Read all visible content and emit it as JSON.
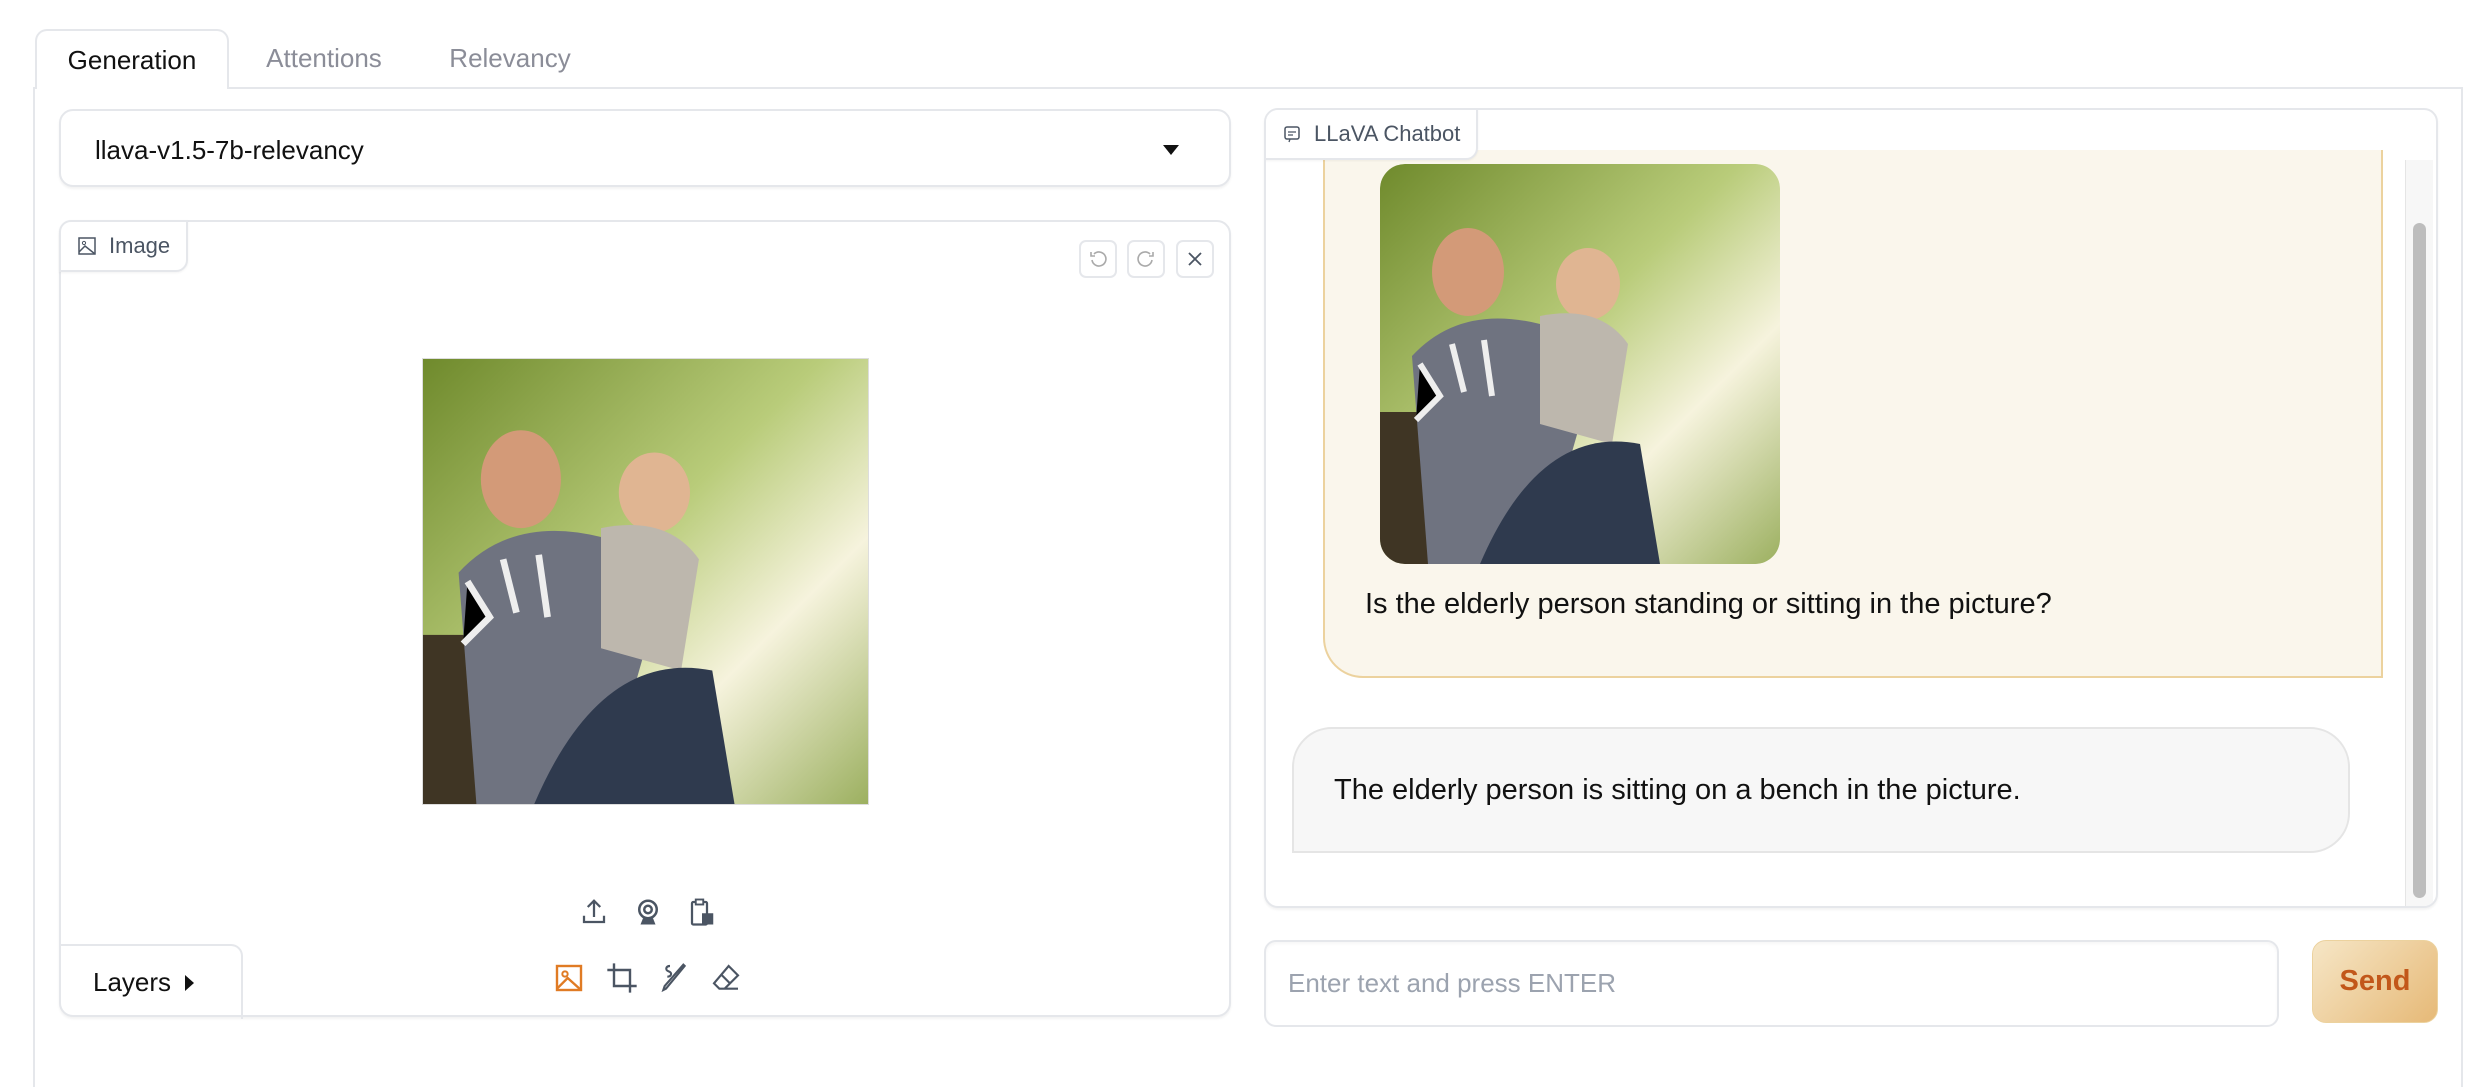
{
  "tabs": [
    {
      "label": "Generation",
      "active": true
    },
    {
      "label": "Attentions",
      "active": false
    },
    {
      "label": "Relevancy",
      "active": false
    }
  ],
  "model_select": {
    "value": "llava-v1.5-7b-relevancy"
  },
  "image_panel": {
    "label": "Image",
    "layers_label": "Layers",
    "icons": [
      "image-icon",
      "undo-icon",
      "redo-icon",
      "close-icon",
      "upload-icon",
      "webcam-icon",
      "clipboard-icon",
      "crop-icon",
      "brush-icon",
      "eraser-icon"
    ]
  },
  "chatbot": {
    "label": "LLaVA Chatbot",
    "messages": [
      {
        "role": "user",
        "text": "Is the elderly person standing or sitting in the picture?",
        "has_image": true
      },
      {
        "role": "bot",
        "text": "The elderly person is sitting on a bench in the picture."
      }
    ]
  },
  "input": {
    "placeholder": "Enter text and press ENTER",
    "value": ""
  },
  "send_label": "Send",
  "colors": {
    "accent": "#e07b24",
    "send_text": "#c2571a",
    "user_bubble": "#faf6ec",
    "user_border": "#ecd29e"
  }
}
